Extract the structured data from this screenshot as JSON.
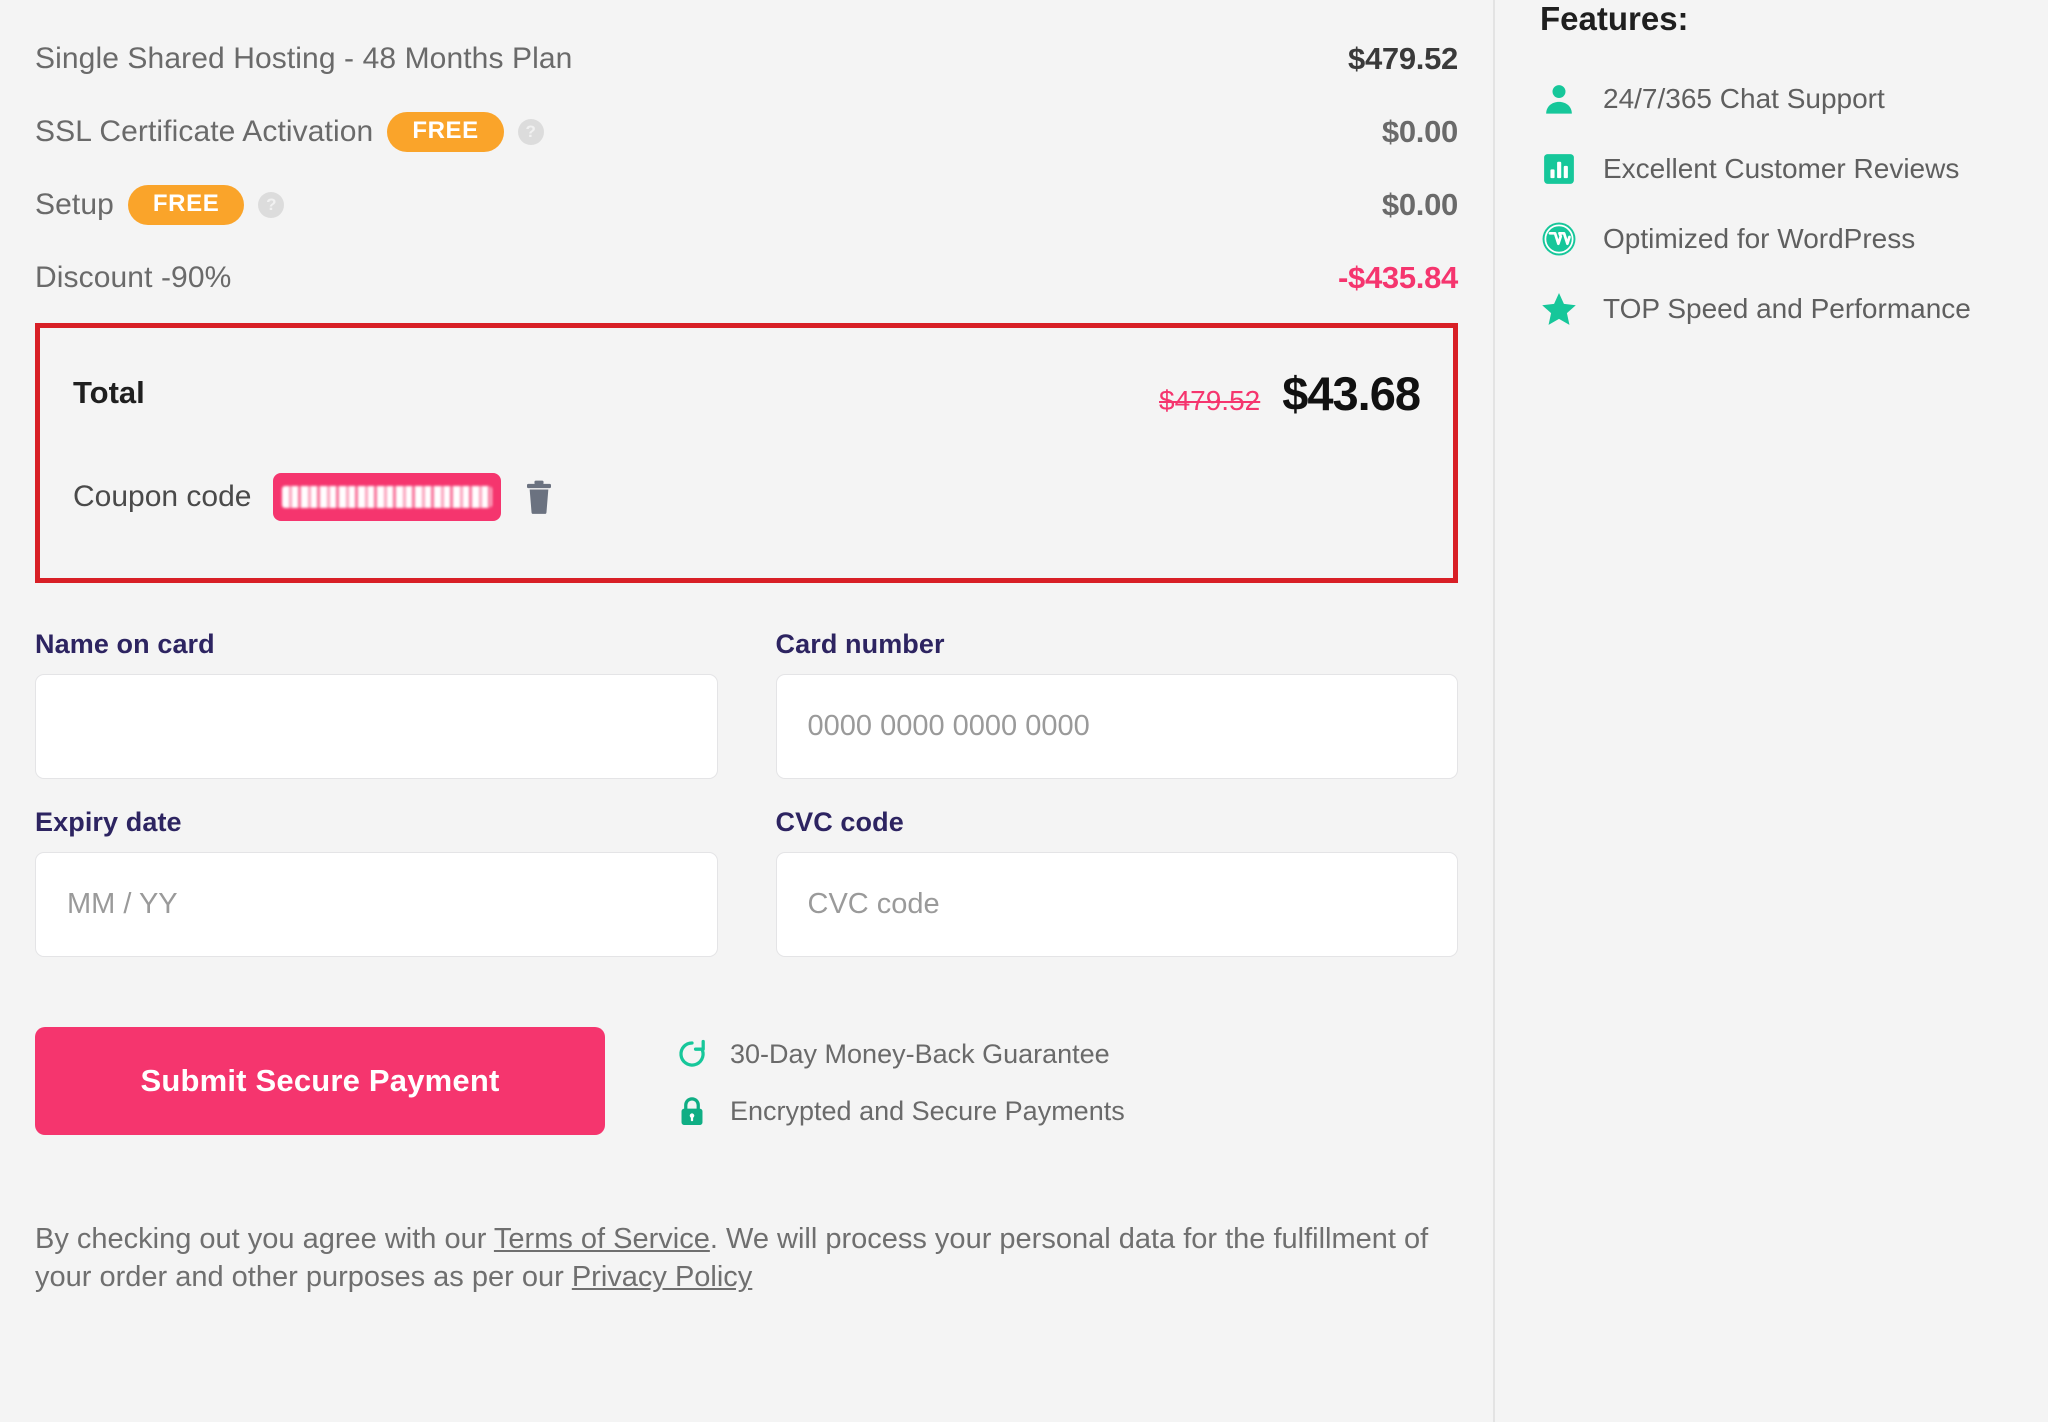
{
  "order_summary": {
    "rows": [
      {
        "label": "Single Shared Hosting - 48 Months Plan",
        "badge": null,
        "has_info": false,
        "price": "$479.52",
        "price_style": "bold"
      },
      {
        "label": "SSL Certificate Activation",
        "badge": "FREE",
        "has_info": true,
        "price": "$0.00",
        "price_style": "muted"
      },
      {
        "label": "Setup",
        "badge": "FREE",
        "has_info": true,
        "price": "$0.00",
        "price_style": "muted"
      },
      {
        "label": "Discount -90%",
        "badge": null,
        "has_info": false,
        "price": "-$435.84",
        "price_style": "negative"
      }
    ]
  },
  "total_block": {
    "total_label": "Total",
    "original_price": "$479.52",
    "final_price": "$43.68",
    "coupon_label": "Coupon code",
    "coupon_value": "",
    "coupon_redacted": true,
    "delete_coupon_title": "Remove coupon"
  },
  "payment_form": {
    "name_on_card": {
      "label": "Name on card",
      "value": "",
      "placeholder": ""
    },
    "card_number": {
      "label": "Card number",
      "value": "",
      "placeholder": "0000 0000 0000 0000"
    },
    "expiry_date": {
      "label": "Expiry date",
      "value": "",
      "placeholder": "MM / YY"
    },
    "cvc_code": {
      "label": "CVC code",
      "value": "",
      "placeholder": "CVC code"
    }
  },
  "submit": {
    "button_label": "Submit Secure Payment"
  },
  "trust_badges": [
    {
      "icon": "refresh-icon",
      "label": "30-Day Money-Back Guarantee"
    },
    {
      "icon": "lock-icon",
      "label": "Encrypted and Secure Payments"
    }
  ],
  "legal": {
    "part1": "By checking out you agree with our ",
    "terms_link": "Terms of Service",
    "part2": ". We will process your personal data for the fulfillment of your order and other purposes as per our ",
    "privacy_link": "Privacy Policy"
  },
  "sidebar": {
    "title": "Features:",
    "items": [
      {
        "icon": "person-icon",
        "label": "24/7/365 Chat Support"
      },
      {
        "icon": "bar-chart-icon",
        "label": "Excellent Customer Reviews"
      },
      {
        "icon": "wordpress-icon",
        "label": "Optimized for WordPress"
      },
      {
        "icon": "star-icon",
        "label": "TOP Speed and Performance"
      }
    ]
  },
  "colors": {
    "accent_pink": "#f5356e",
    "badge_orange": "#faa42a",
    "teal": "#16c79a",
    "annotation_red": "#d81f26",
    "label_navy": "#2d2461",
    "page_bg": "#f4f4f4"
  }
}
